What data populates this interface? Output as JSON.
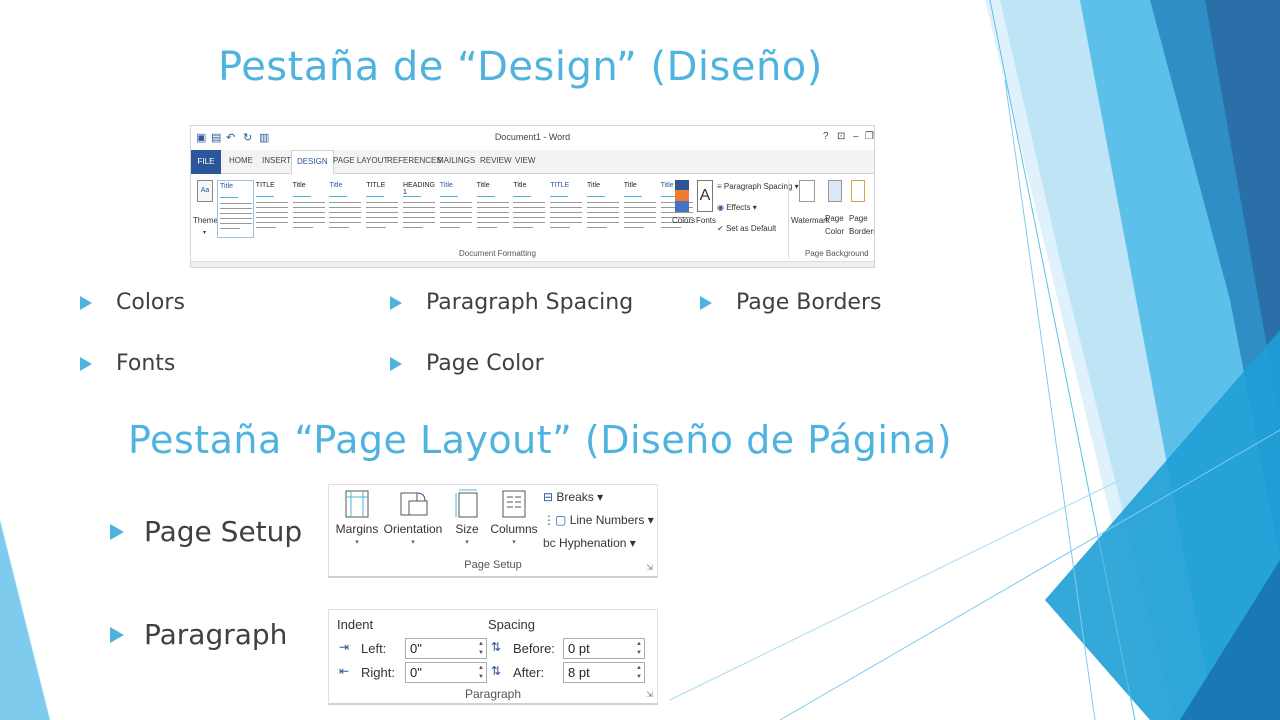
{
  "slide": {
    "title_design": "Pestaña de “Design” (Diseño)",
    "title_layout": "Pestaña “Page Layout” (Diseño de Página)",
    "design_bullets": [
      {
        "label": "Colors"
      },
      {
        "label": "Fonts"
      },
      {
        "label": "Paragraph Spacing"
      },
      {
        "label": "Page Color"
      },
      {
        "label": "Page Borders"
      }
    ],
    "layout_bullets": [
      {
        "label": "Page Setup"
      },
      {
        "label": "Paragraph"
      }
    ]
  },
  "ribbon": {
    "window_title": "Document1 - Word",
    "window_controls": [
      "?",
      "⊡",
      "–",
      "❐"
    ],
    "tabs": [
      "FILE",
      "HOME",
      "INSERT",
      "DESIGN",
      "PAGE LAYOUT",
      "REFERENCES",
      "MAILINGS",
      "REVIEW",
      "VIEW"
    ],
    "active_tab": "DESIGN",
    "themes_label": "Themes",
    "style_thumbs": [
      "Title",
      "TITLE",
      "Title",
      "Title",
      "TITLE",
      "HEADING 1",
      "Title",
      "Title",
      "Title",
      "TITLE",
      "Title",
      "Title",
      "Title"
    ],
    "colors_label": "Colors",
    "fonts_label": "Fonts",
    "paragraph_spacing_label": "Paragraph Spacing",
    "effects_label": "Effects",
    "set_as_default_label": "Set as Default",
    "watermark_label": "Watermark",
    "page_color_label": "Page Color",
    "page_borders_label": "Page Borders",
    "group_document_formatting": "Document Formatting",
    "group_page_background": "Page Background"
  },
  "page_setup": {
    "margins_label": "Margins",
    "orientation_label": "Orientation",
    "size_label": "Size",
    "columns_label": "Columns",
    "breaks_label": "Breaks",
    "line_numbers_label": "Line Numbers",
    "hyphenation_label": "Hyphenation",
    "group_label": "Page Setup"
  },
  "paragraph": {
    "indent_heading": "Indent",
    "spacing_heading": "Spacing",
    "left_label": "Left:",
    "right_label": "Right:",
    "before_label": "Before:",
    "after_label": "After:",
    "left_value": "0\"",
    "right_value": "0\"",
    "before_value": "0 pt",
    "after_value": "8 pt",
    "group_label": "Paragraph"
  },
  "colors": {
    "accent": "#4fb3e0",
    "word_blue": "#2b579a",
    "body_text": "#404040"
  }
}
